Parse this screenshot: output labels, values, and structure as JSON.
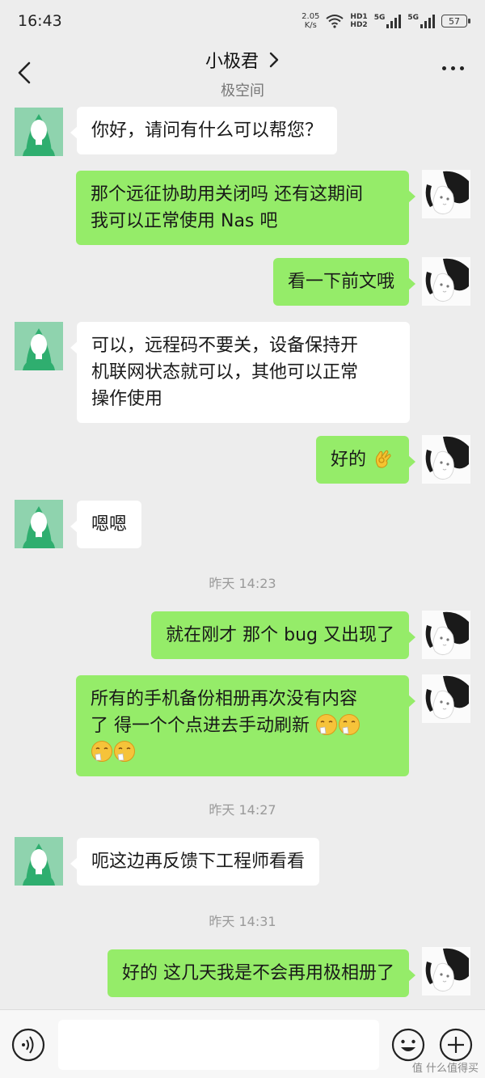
{
  "status_bar": {
    "time": "16:43",
    "net_speed_value": "2.05",
    "net_speed_unit": "K/s",
    "hd1": "HD1",
    "hd2": "HD2",
    "sim1": "5G",
    "sim2": "5G",
    "battery": "57"
  },
  "header": {
    "title": "小极君",
    "subtitle": "极空间"
  },
  "messages": [
    {
      "side": "left",
      "text": "你好，请问有什么可以帮您？"
    },
    {
      "side": "right",
      "text_line1": "那个远征协助用关闭吗 还有这期间",
      "text_line2": "我可以正常使用 Nas 吧"
    },
    {
      "side": "right",
      "text": "看一下前文哦"
    },
    {
      "side": "left",
      "text_line1": "可以，远程码不要关，设备保持开",
      "text_line2": "机联网状态就可以，其他可以正常",
      "text_line3": "操作使用"
    },
    {
      "side": "right",
      "text": "好的"
    },
    {
      "side": "left",
      "text": "嗯嗯"
    },
    {
      "side": "right",
      "text": "就在刚才 那个 bug 又出现了"
    },
    {
      "side": "right",
      "text_line1": "所有的手机备份相册再次没有内容",
      "text_line2": "了 得一个个点进去手动刷新"
    },
    {
      "side": "left",
      "text": "呃这边再反馈下工程师看看"
    },
    {
      "side": "right",
      "text": "好的 这几天我是不会再用极相册了"
    }
  ],
  "timestamps": [
    "昨天 14:23",
    "昨天 14:27",
    "昨天 14:31"
  ],
  "input": {
    "value": "",
    "placeholder": ""
  },
  "icons": {
    "voice": "voice-icon",
    "emoji": "smiley-icon",
    "plus": "plus-icon",
    "ok_hand": "ok-hand-emoji",
    "sneeze": "sneezing-face-emoji"
  },
  "colors": {
    "background": "#ededed",
    "bubble_self": "#95ec69",
    "bubble_other": "#ffffff",
    "avatar_service": "#8fd3ae",
    "avatar_service_dark": "#2fae6f"
  },
  "watermark": "值 什么值得买"
}
